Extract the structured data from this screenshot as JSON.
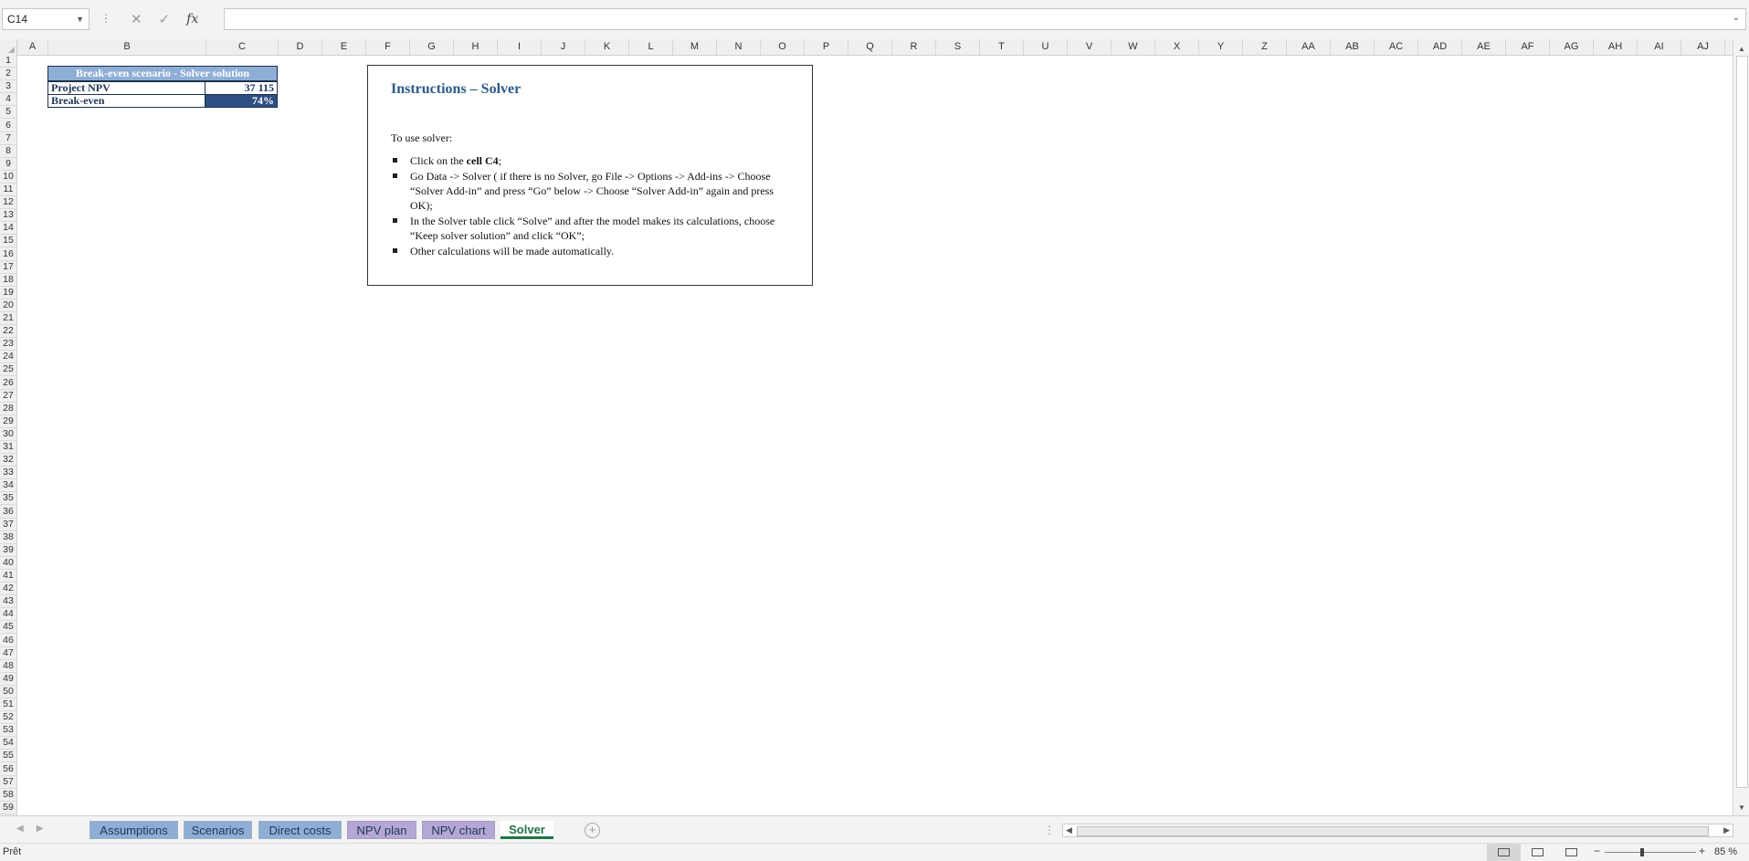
{
  "formula_bar": {
    "name_box": "C14",
    "formula": ""
  },
  "columns": [
    "A",
    "B",
    "C",
    "D",
    "E",
    "F",
    "G",
    "H",
    "I",
    "J",
    "K",
    "L",
    "M",
    "N",
    "O",
    "P",
    "Q",
    "R",
    "S",
    "T",
    "U",
    "V",
    "W",
    "X",
    "Y",
    "Z",
    "AA",
    "AB",
    "AC",
    "AD",
    "AE",
    "AF",
    "AG",
    "AH",
    "AI",
    "AJ"
  ],
  "rows": [
    "1",
    "2",
    "3",
    "4",
    "5",
    "6",
    "7",
    "8",
    "9",
    "10",
    "11",
    "12",
    "13",
    "14",
    "15",
    "16",
    "17",
    "18",
    "19",
    "20",
    "21",
    "22",
    "23",
    "24",
    "25",
    "26",
    "27",
    "28",
    "29",
    "30",
    "31",
    "32",
    "33",
    "34",
    "35",
    "36",
    "37",
    "38",
    "39",
    "40",
    "41",
    "42",
    "43",
    "44",
    "45",
    "46",
    "47",
    "48",
    "49",
    "50",
    "51",
    "52",
    "53",
    "54",
    "55",
    "56",
    "57",
    "58",
    "59"
  ],
  "table": {
    "title": "Break-even scenario - Solver solution",
    "npv_label": "Project NPV",
    "npv_value": "37 115",
    "breakeven_label": "Break-even",
    "breakeven_value": "74%"
  },
  "instructions": {
    "title": "Instructions – Solver",
    "intro": "To use solver:",
    "step1_prefix": "Click on the ",
    "step1_bold": "cell C4",
    "step1_suffix": ";",
    "step2": "Go Data -> Solver ( if there is no Solver, go File -> Options -> Add-ins -> Choose “Solver Add-in” and press “Go” below -> Choose “Solver Add-in” again and press OK);",
    "step3": "In the Solver table click “Solve” and after the model makes its calculations, choose “Keep solver solution” and click “OK”;",
    "step4": "Other calculations will be made automatically."
  },
  "tabs": {
    "assumptions": "Assumptions",
    "scenarios": "Scenarios",
    "direct_costs": "Direct costs",
    "npv_plan": "NPV plan",
    "npv_chart": "NPV chart",
    "solver": "Solver"
  },
  "status": {
    "ready": "Prêt",
    "zoom": "85 %"
  },
  "colors": {
    "header_blue": "#8eaed6",
    "dark_blue": "#2e4f82",
    "tab_purple": "#b4a7d6",
    "active_green": "#217346"
  }
}
